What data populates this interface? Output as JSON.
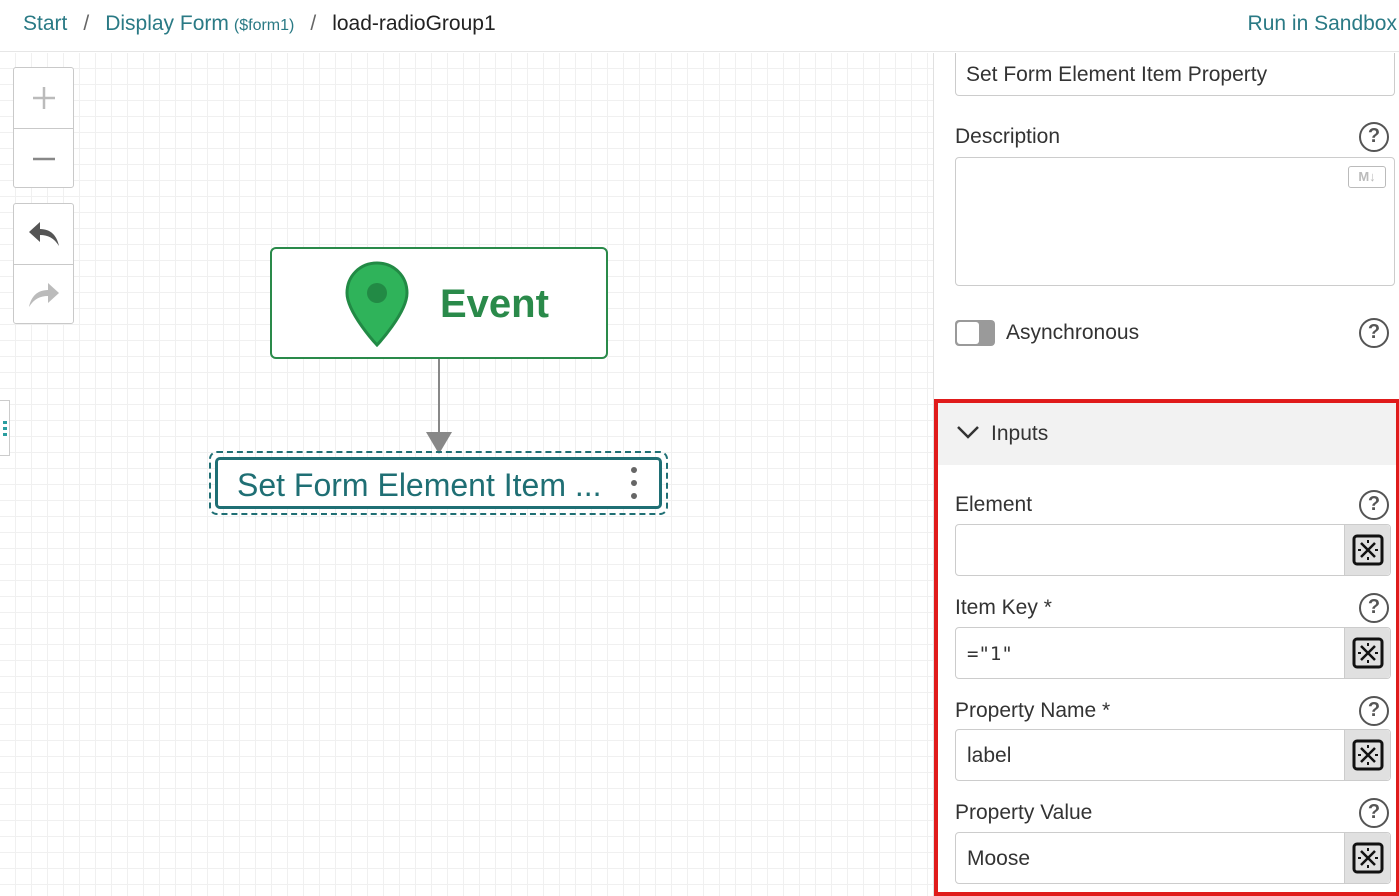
{
  "breadcrumb": {
    "start": "Start",
    "form": "Display Form",
    "form_var": "($form1)",
    "current": "load-radioGroup1",
    "separator": "/"
  },
  "header": {
    "run_sandbox": "Run in Sandbox"
  },
  "canvas": {
    "zoom_in_icon": "plus-icon",
    "zoom_out_icon": "minus-icon",
    "undo_icon": "undo-icon",
    "redo_icon": "redo-icon",
    "event_node": {
      "label": "Event",
      "icon": "map-pin-icon",
      "color": "#2a8a4a"
    },
    "action_node": {
      "label": "Set Form Element Item ...",
      "color": "#1f6f74"
    }
  },
  "panel": {
    "name_value": "Set Form Element Item Property",
    "description_label": "Description",
    "markdown_badge": "M↓",
    "async_label": "Asynchronous",
    "async_enabled": false,
    "inputs": {
      "title": "Inputs",
      "fields": [
        {
          "label": "Element",
          "value": ""
        },
        {
          "label": "Item Key *",
          "value": "=\"1\""
        },
        {
          "label": "Property Name *",
          "value": "label"
        },
        {
          "label": "Property Value",
          "value": "Moose"
        }
      ]
    },
    "help_glyph": "?"
  },
  "colors": {
    "accent": "#2a7a85",
    "highlight_border": "#e01b1b"
  }
}
